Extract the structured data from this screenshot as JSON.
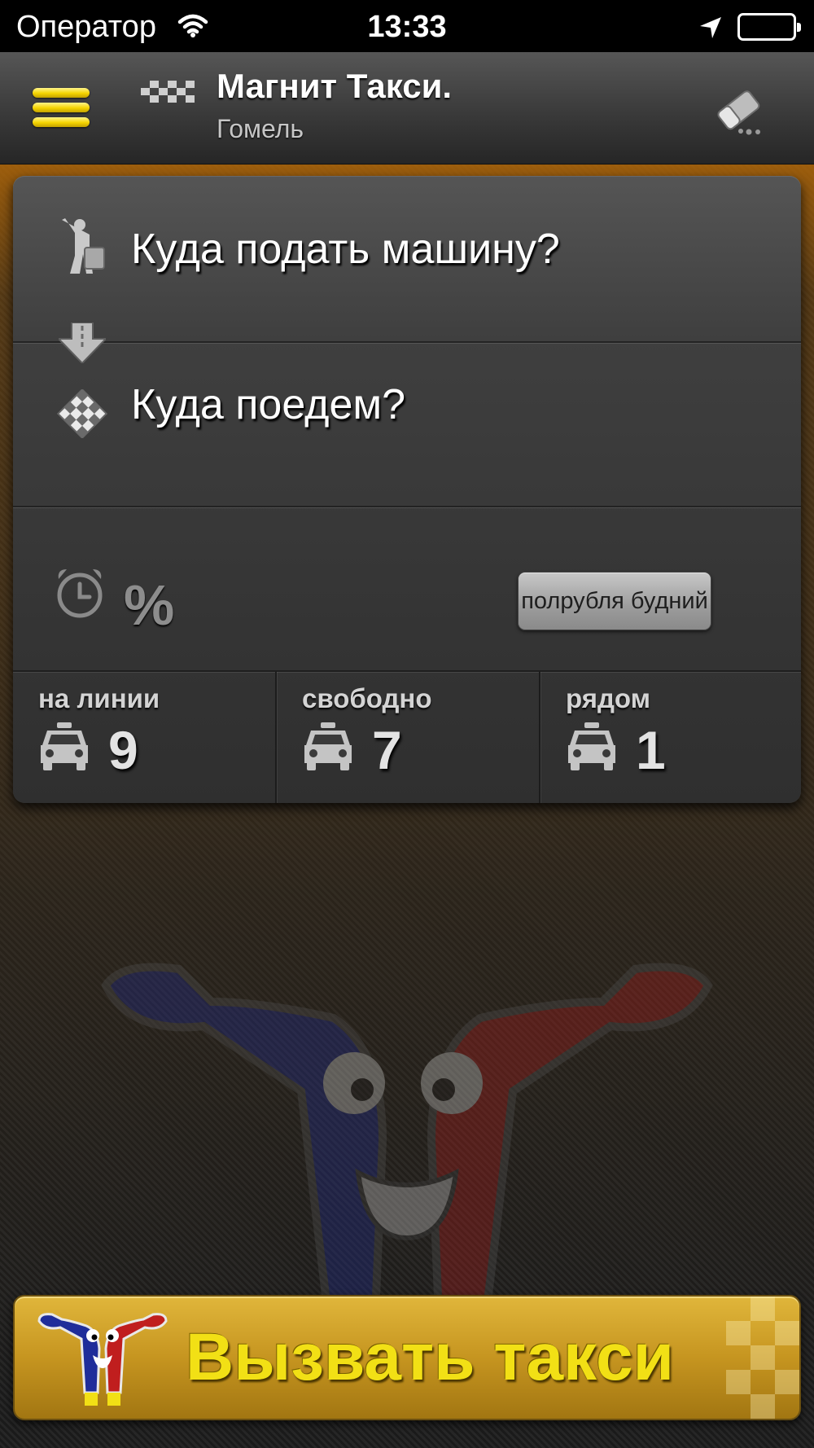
{
  "status_bar": {
    "carrier": "Оператор",
    "time": "13:33"
  },
  "header": {
    "title": "Магнит Такси.",
    "city": "Гомель"
  },
  "order": {
    "pickup_prompt": "Куда подать машину?",
    "destination_prompt": "Куда поедем?",
    "discount_symbol": "%",
    "tariff_button": "полрубля будний"
  },
  "stats": [
    {
      "label": "на линии",
      "value": "9"
    },
    {
      "label": "свободно",
      "value": "7"
    },
    {
      "label": "рядом",
      "value": "1"
    }
  ],
  "call_button": {
    "label": "Вызвать такси"
  },
  "colors": {
    "accent_yellow": "#f5d400",
    "call_button_gold": "#c69520",
    "header_gray": "#3a3a3a",
    "mascot_blue": "#1f2d9a",
    "mascot_red": "#b81d1d"
  },
  "icons": {
    "menu": "menu-icon",
    "logo": "checker-logo-icon",
    "clear": "eraser-icon",
    "pickup": "person-hailing-icon",
    "route": "arrow-down-icon",
    "destination": "checkered-flag-icon",
    "schedule": "alarm-clock-icon",
    "car": "taxi-car-icon"
  }
}
